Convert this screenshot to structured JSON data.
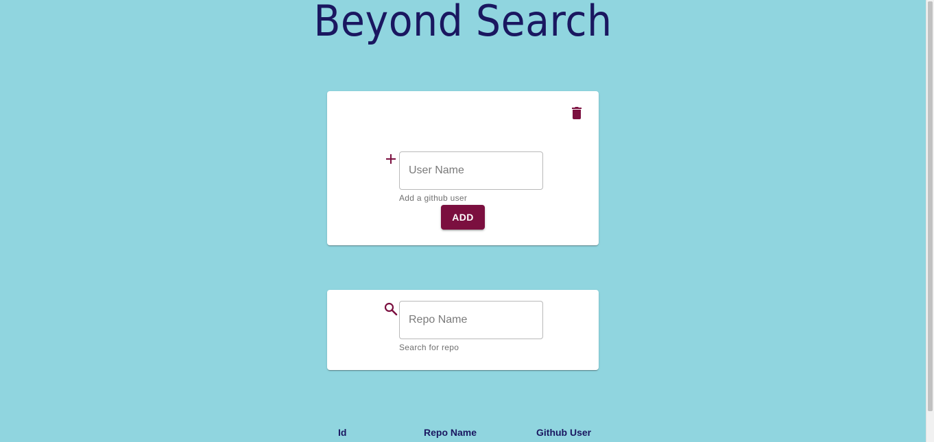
{
  "page": {
    "title": "Beyond Search"
  },
  "add_card": {
    "user_placeholder": "User Name",
    "user_value": "",
    "helper_text": "Add a github user",
    "add_label": "ADD",
    "icons": [
      "delete-icon",
      "plus-icon"
    ]
  },
  "search_card": {
    "repo_placeholder": "Repo Name",
    "repo_value": "",
    "helper_text": "Search for repo",
    "icons": [
      "search-icon"
    ]
  },
  "table": {
    "columns": [
      "Id",
      "Repo Name",
      "Github User"
    ]
  },
  "colors": {
    "background": "#90d5df",
    "accent": "#7b0f3f",
    "title": "#1a1760"
  }
}
